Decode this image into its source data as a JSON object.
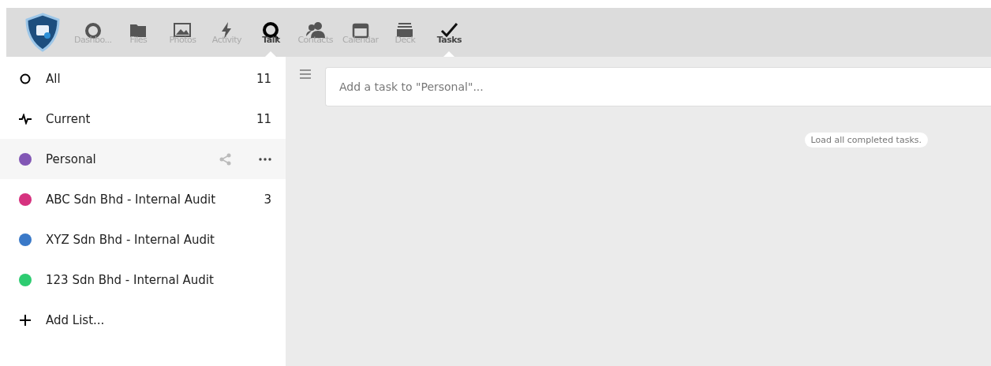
{
  "apps": [
    {
      "kind": "dashboard",
      "label": "Dashbo...",
      "selected": false
    },
    {
      "kind": "files",
      "label": "Files",
      "selected": false
    },
    {
      "kind": "photos",
      "label": "Photos",
      "selected": false
    },
    {
      "kind": "activity",
      "label": "Activity",
      "selected": false
    },
    {
      "kind": "talk",
      "label": "Talk",
      "selected": true
    },
    {
      "kind": "contacts",
      "label": "Contacts",
      "selected": false
    },
    {
      "kind": "calendar",
      "label": "Calendar",
      "selected": false
    },
    {
      "kind": "deck",
      "label": "Deck",
      "selected": false
    },
    {
      "kind": "tasks",
      "label": "Tasks",
      "selected": true
    }
  ],
  "sidebar": {
    "items": [
      {
        "kind": "all",
        "label": "All",
        "count": "11",
        "selected": false
      },
      {
        "kind": "current",
        "label": "Current",
        "count": "11",
        "selected": false
      },
      {
        "kind": "list",
        "label": "Personal",
        "color": "#8257b5",
        "selected": true
      },
      {
        "kind": "list",
        "label": "ABC Sdn Bhd - Internal Audit",
        "count": "3",
        "color": "#d6327f",
        "selected": false
      },
      {
        "kind": "list",
        "label": "XYZ Sdn Bhd - Internal Audit",
        "color": "#3a79c8",
        "selected": false
      },
      {
        "kind": "list",
        "label": "123 Sdn Bhd - Internal Audit",
        "color": "#2ecc71",
        "selected": false
      },
      {
        "kind": "add",
        "label": "Add List...",
        "selected": false
      }
    ]
  },
  "task_input": {
    "placeholder": "Add a task to \"Personal\"..."
  },
  "load_completed": "Load all completed tasks."
}
